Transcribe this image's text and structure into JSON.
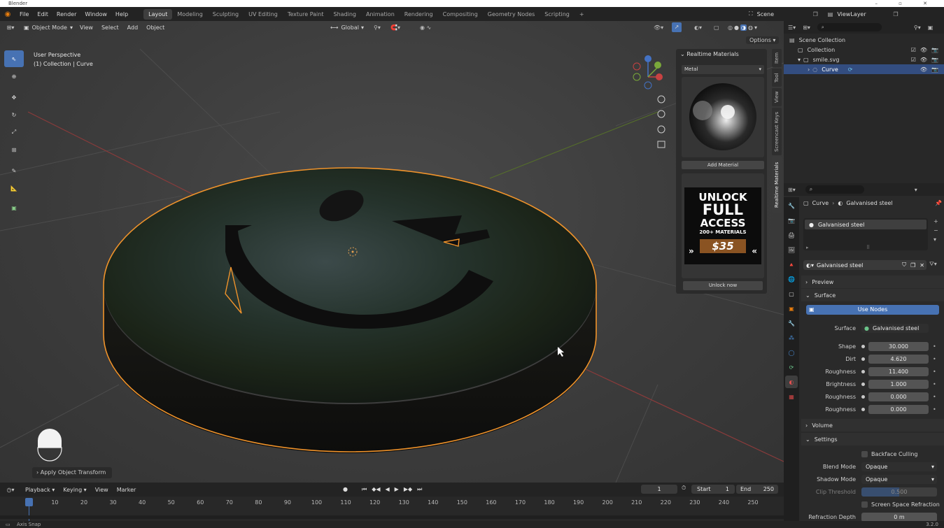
{
  "window": {
    "title": "Blender"
  },
  "menu": [
    "File",
    "Edit",
    "Render",
    "Window",
    "Help"
  ],
  "workspaces": [
    {
      "label": "Layout",
      "active": true
    },
    {
      "label": "Modeling"
    },
    {
      "label": "Sculpting"
    },
    {
      "label": "UV Editing"
    },
    {
      "label": "Texture Paint"
    },
    {
      "label": "Shading"
    },
    {
      "label": "Animation"
    },
    {
      "label": "Rendering"
    },
    {
      "label": "Compositing"
    },
    {
      "label": "Geometry Nodes"
    },
    {
      "label": "Scripting"
    }
  ],
  "add_workspace": "+",
  "scene": {
    "name": "Scene",
    "view_layer": "ViewLayer"
  },
  "viewport_header": {
    "mode": "Object Mode",
    "menus": [
      "View",
      "Select",
      "Add",
      "Object"
    ],
    "orientation": "Global",
    "options": "Options"
  },
  "viewport": {
    "perspective": "User Perspective",
    "collection_info": "(1) Collection | Curve",
    "operator_panel": "Apply Object Transform"
  },
  "realtime_materials": {
    "title": "Realtime Materials",
    "category": "Metal",
    "add_button": "Add Material",
    "promo_line1": "UNLOCK",
    "promo_line2": "FULL",
    "promo_line3": "ACCESS",
    "promo_line4": "200+ MATERIALS",
    "promo_price": "$35",
    "unlock_button": "Unlock now"
  },
  "n_tabs": [
    "Item",
    "Tool",
    "View",
    "Screencast Keys",
    "Realtime Materials"
  ],
  "outliner": {
    "scene_collection": "Scene Collection",
    "rows": [
      {
        "label": "Collection",
        "indent": 1
      },
      {
        "label": "smile.svg",
        "indent": 1
      },
      {
        "label": "Curve",
        "indent": 2,
        "selected": true
      }
    ]
  },
  "properties": {
    "breadcrumb_object": "Curve",
    "breadcrumb_material": "Galvanised steel",
    "slot": "Galvanised steel",
    "material_name": "Galvanised steel",
    "sections": {
      "preview": "Preview",
      "surface": "Surface",
      "volume": "Volume",
      "settings": "Settings"
    },
    "use_nodes": "Use Nodes",
    "surface_label": "Surface",
    "surface_value": "Galvanised steel",
    "params": [
      {
        "label": "Shape",
        "value": "30.000"
      },
      {
        "label": "Dirt",
        "value": "4.620"
      },
      {
        "label": "Roughness",
        "value": "11.400"
      },
      {
        "label": "Brightness",
        "value": "1.000"
      },
      {
        "label": "Roughness",
        "value": "0.000"
      },
      {
        "label": "Roughness",
        "value": "0.000"
      }
    ],
    "backface_culling": "Backface Culling",
    "blend_mode_label": "Blend Mode",
    "blend_mode": "Opaque",
    "shadow_mode_label": "Shadow Mode",
    "shadow_mode": "Opaque",
    "clip_threshold_label": "Clip Threshold",
    "clip_threshold": "0.500",
    "screen_space_refraction": "Screen Space Refraction",
    "refraction_depth_label": "Refraction Depth",
    "refraction_depth": "0 m"
  },
  "timeline": {
    "menus": [
      "Playback",
      "Keying",
      "View",
      "Marker"
    ],
    "current_frame": "1",
    "start_label": "Start",
    "start": "1",
    "end_label": "End",
    "end": "250",
    "ticks": [
      "1",
      "10",
      "20",
      "30",
      "40",
      "50",
      "60",
      "70",
      "80",
      "90",
      "100",
      "110",
      "120",
      "130",
      "140",
      "150",
      "160",
      "170",
      "180",
      "190",
      "200",
      "210",
      "220",
      "230",
      "240",
      "250"
    ]
  },
  "status": {
    "left": "Axis Snap",
    "version": "3.2.0"
  },
  "colors": {
    "accent": "#4772b3",
    "selection_outline": "#f0932b",
    "axis_red": "#c84242",
    "axis_green": "#7aa83a"
  }
}
